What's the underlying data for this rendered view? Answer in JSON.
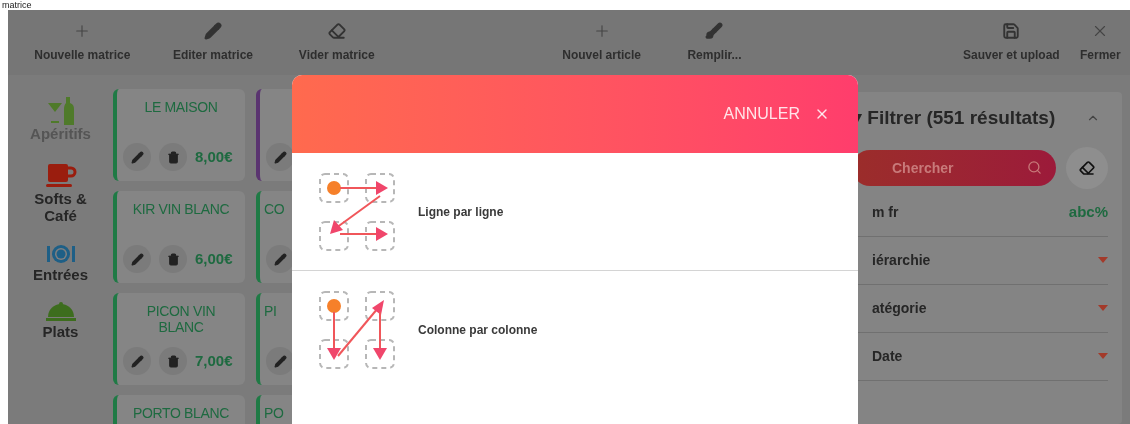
{
  "caption": "matrice",
  "toolbar": [
    {
      "label": "Nouvelle matrice"
    },
    {
      "label": "Editer matrice"
    },
    {
      "label": "Vider matrice"
    },
    {
      "label": "Nouvel article"
    },
    {
      "label": "Remplir..."
    },
    {
      "label": "Sauver et upload"
    },
    {
      "label": "Fermer"
    }
  ],
  "categories": [
    {
      "label": "Apéritifs",
      "selected": true
    },
    {
      "label": "Softs & Café",
      "selected": false
    },
    {
      "label": "Entrées",
      "selected": false
    },
    {
      "label": "Plats",
      "selected": false
    }
  ],
  "articles": [
    {
      "name": "LE MAISON",
      "price": "8,00€",
      "color": "#1f7a45"
    },
    {
      "color": "#5a3470"
    },
    {
      "name": "KIR VIN BLANC",
      "price": "6,00€",
      "color": "#1f7a45"
    },
    {
      "name": "CO",
      "color": "#1f7a45"
    },
    {
      "name": "PICON VIN BLANC",
      "price": "7,00€",
      "color": "#1f7a45"
    },
    {
      "name": "PI",
      "color": "#1f7a45"
    },
    {
      "name": "PORTO BLANC",
      "color": "#1f7a45"
    },
    {
      "name": "PO",
      "color": "#1f7a45"
    }
  ],
  "filter": {
    "title": "Filtrer (551 résultats)",
    "search_placeholder": "Chercher",
    "fields": [
      {
        "label": "m fr",
        "kind": "text",
        "value": "abc%"
      },
      {
        "label": "iérarchie",
        "kind": "select"
      },
      {
        "label": "atégorie",
        "kind": "select"
      },
      {
        "label": "Date",
        "kind": "select"
      }
    ]
  },
  "dialog": {
    "cancel": "ANNULER",
    "options": [
      {
        "label": "Ligne par ligne",
        "kind": "rows"
      },
      {
        "label": "Colonne par colonne",
        "kind": "columns"
      }
    ]
  }
}
